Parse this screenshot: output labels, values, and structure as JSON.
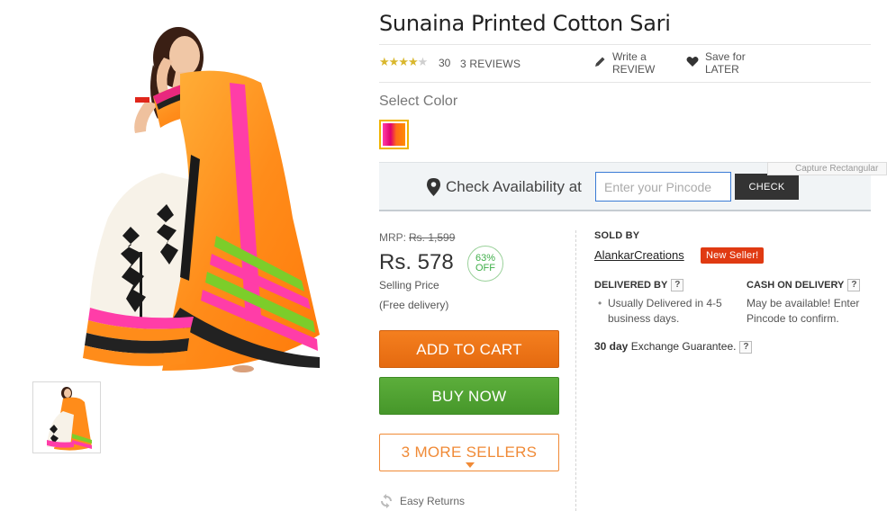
{
  "product": {
    "title": "Sunaina Printed Cotton Sari",
    "rating": 4,
    "rating_max": 5,
    "rating_count": "30",
    "reviews_label": "3 REVIEWS",
    "write_review": "Write a REVIEW",
    "save_for_later": "Save for LATER"
  },
  "color": {
    "label": "Select Color",
    "selected": "orange-pink"
  },
  "pincode": {
    "label": "Check Availability at",
    "placeholder": "Enter your Pincode",
    "button": "CHECK"
  },
  "overlay": {
    "capture_tag": "Capture Rectangular"
  },
  "pricing": {
    "mrp_label": "MRP:",
    "mrp_value": "Rs. 1,599",
    "price": "Rs. 578",
    "discount_pct": "63%",
    "discount_word": "OFF",
    "selling_label": "Selling Price",
    "delivery_note": "(Free delivery)"
  },
  "actions": {
    "add_to_cart": "ADD TO CART",
    "buy_now": "BUY NOW",
    "more_sellers": "3 MORE SELLERS",
    "easy_returns": "Easy Returns"
  },
  "seller": {
    "sold_by_label": "SOLD BY",
    "name": "AlankarCreations",
    "badge": "New Seller!",
    "delivered_by_label": "DELIVERED BY",
    "delivered_by_text": "Usually Delivered in 4-5 business days.",
    "cod_label": "CASH ON DELIVERY",
    "cod_text": "May be available! Enter Pincode to confirm.",
    "exchange_days": "30 day",
    "exchange_text": "Exchange Guarantee.",
    "help_mark": "?"
  },
  "colors": {
    "accent_orange": "#f47f1f",
    "accent_green": "#4fa132",
    "badge_red": "#e03a12",
    "star_gold": "#d9b72d"
  }
}
